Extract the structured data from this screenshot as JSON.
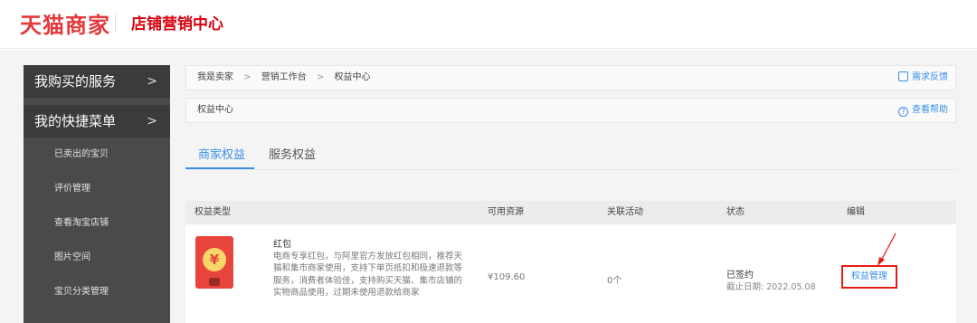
{
  "brand": {
    "logo": "天猫商家",
    "subtitle": "店铺营销中心",
    "brand_color": "#e4393c"
  },
  "sidebar": {
    "sections": [
      {
        "label": "我购买的服务",
        "chevron": ">"
      },
      {
        "label": "我的快捷菜单",
        "chevron": ">"
      }
    ],
    "items": [
      {
        "label": "已卖出的宝贝"
      },
      {
        "label": "评价管理"
      },
      {
        "label": "查看淘宝店铺"
      },
      {
        "label": "图片空间"
      },
      {
        "label": "宝贝分类管理"
      }
    ]
  },
  "breadcrumb": {
    "items": [
      "我是卖家",
      "营销工作台",
      "权益中心"
    ],
    "separator": ">",
    "feedback": "需求反馈"
  },
  "page_header": {
    "title": "权益中心",
    "help": "查看帮助"
  },
  "tabs": [
    {
      "label": "商家权益",
      "active": true
    },
    {
      "label": "服务权益",
      "active": false
    }
  ],
  "table": {
    "headers": [
      "权益类型",
      "可用资源",
      "关联活动",
      "状态",
      "编辑"
    ],
    "rows": [
      {
        "icon": "red-envelope-icon",
        "coin": "¥",
        "title": "红包",
        "description": "电商专享红包，与阿里官方发放红包相同，推荐天猫和集市商家使用，支持下单页抵扣和极速退款等服务，消费者体验佳，支持购买天猫、集市店铺的实物商品使用，过期未使用退款给商家",
        "resource": "¥109.60",
        "activity": "0个",
        "status": "已签约",
        "deadline": "截止日期: 2022.05.08",
        "action": "权益管理"
      }
    ]
  },
  "colors": {
    "accent": "#3a8ee6",
    "highlight": "#e41e16",
    "sidebar": "#4a4a4a"
  }
}
